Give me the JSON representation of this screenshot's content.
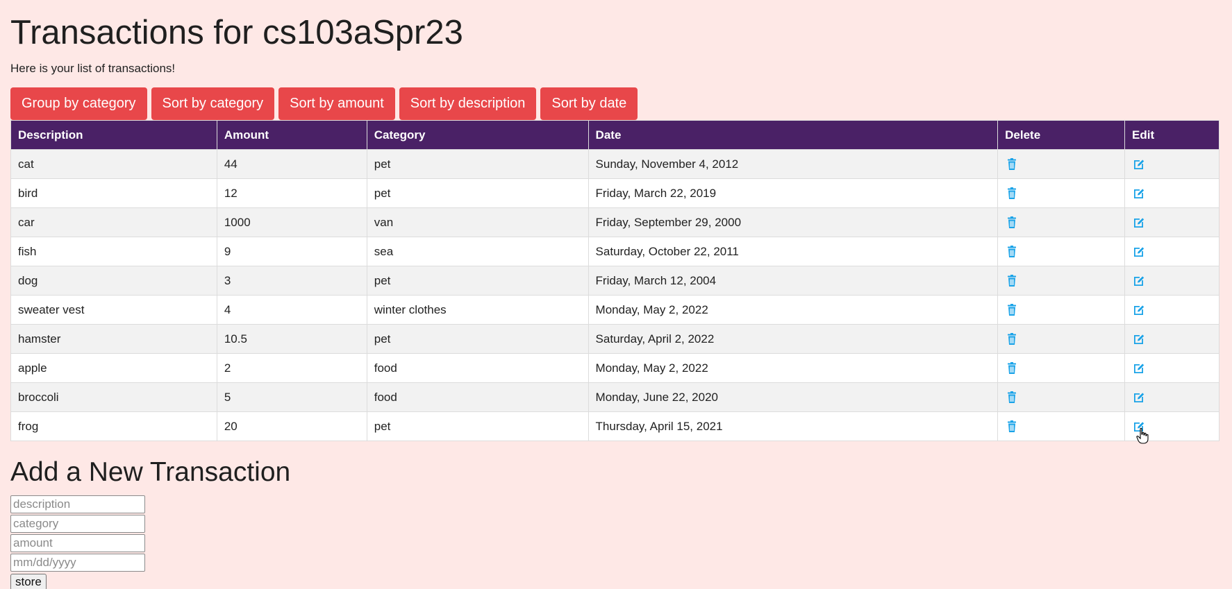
{
  "page": {
    "title": "Transactions for cs103aSpr23",
    "subtitle": "Here is your list of transactions!"
  },
  "toolbar": {
    "buttons": [
      {
        "label": "Group by category"
      },
      {
        "label": "Sort by category"
      },
      {
        "label": "Sort by amount"
      },
      {
        "label": "Sort by description"
      },
      {
        "label": "Sort by date"
      }
    ]
  },
  "table": {
    "headers": [
      "Description",
      "Amount",
      "Category",
      "Date",
      "Delete",
      "Edit"
    ],
    "rows": [
      {
        "description": "cat",
        "amount": "44",
        "category": "pet",
        "date": "Sunday, November 4, 2012"
      },
      {
        "description": "bird",
        "amount": "12",
        "category": "pet",
        "date": "Friday, March 22, 2019"
      },
      {
        "description": "car",
        "amount": "1000",
        "category": "van",
        "date": "Friday, September 29, 2000"
      },
      {
        "description": "fish",
        "amount": "9",
        "category": "sea",
        "date": "Saturday, October 22, 2011"
      },
      {
        "description": "dog",
        "amount": "3",
        "category": "pet",
        "date": "Friday, March 12, 2004"
      },
      {
        "description": "sweater vest",
        "amount": "4",
        "category": "winter clothes",
        "date": "Monday, May 2, 2022"
      },
      {
        "description": "hamster",
        "amount": "10.5",
        "category": "pet",
        "date": "Saturday, April 2, 2022"
      },
      {
        "description": "apple",
        "amount": "2",
        "category": "food",
        "date": "Monday, May 2, 2022"
      },
      {
        "description": "broccoli",
        "amount": "5",
        "category": "food",
        "date": "Monday, June 22, 2020"
      },
      {
        "description": "frog",
        "amount": "20",
        "category": "pet",
        "date": "Thursday, April 15, 2021"
      }
    ],
    "delete_icon": "trash-icon",
    "edit_icon": "edit-icon",
    "icon_color": "#1aa3e8"
  },
  "add_form": {
    "title": "Add a New Transaction",
    "description_placeholder": "description",
    "category_placeholder": "category",
    "amount_placeholder": "amount",
    "date_placeholder": "mm/dd/yyyy",
    "store_label": "store"
  },
  "colors": {
    "background": "#fee8e6",
    "button": "#e8474a",
    "table_header": "#4a2166"
  }
}
